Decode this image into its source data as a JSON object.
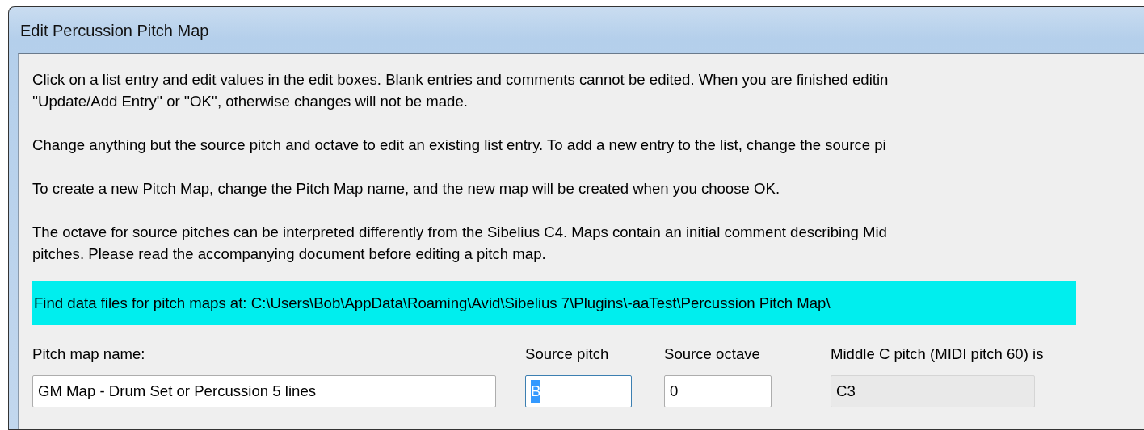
{
  "window": {
    "title": "Edit Percussion Pitch Map"
  },
  "paragraphs": [
    {
      "lines": [
        "Click on a list entry and edit values in the edit boxes. Blank entries and comments cannot be edited. When you are finished editin",
        "''Update/Add Entry'' or ''OK'', otherwise changes will not be made."
      ]
    },
    {
      "lines": [
        "Change anything but the source pitch and octave to edit an existing list entry. To add a new entry to the list, change the source pi"
      ]
    },
    {
      "lines": [
        "To create a new Pitch Map, change the Pitch Map name, and the new map will be created when you choose OK."
      ]
    },
    {
      "lines": [
        "The octave for source pitches can be interpreted differently from the Sibelius C4. Maps contain an initial comment describing Mid",
        "pitches. Please read the accompanying document before editing a pitch map."
      ]
    }
  ],
  "path_note": "Find data files for pitch maps at: C:\\Users\\Bob\\AppData\\Roaming\\Avid\\Sibelius 7\\Plugins\\-aaTest\\Percussion Pitch Map\\",
  "fields": [
    {
      "label": "Pitch map name:",
      "value": "GM Map - Drum Set or Percussion 5 lines",
      "focused": false,
      "disabled": false
    },
    {
      "label": "Source pitch",
      "value": "B",
      "focused": true,
      "disabled": false
    },
    {
      "label": "Source octave",
      "value": "0",
      "focused": false,
      "disabled": false
    },
    {
      "label": "Middle C pitch (MIDI pitch 60) is",
      "value": "C3",
      "focused": false,
      "disabled": true
    }
  ]
}
